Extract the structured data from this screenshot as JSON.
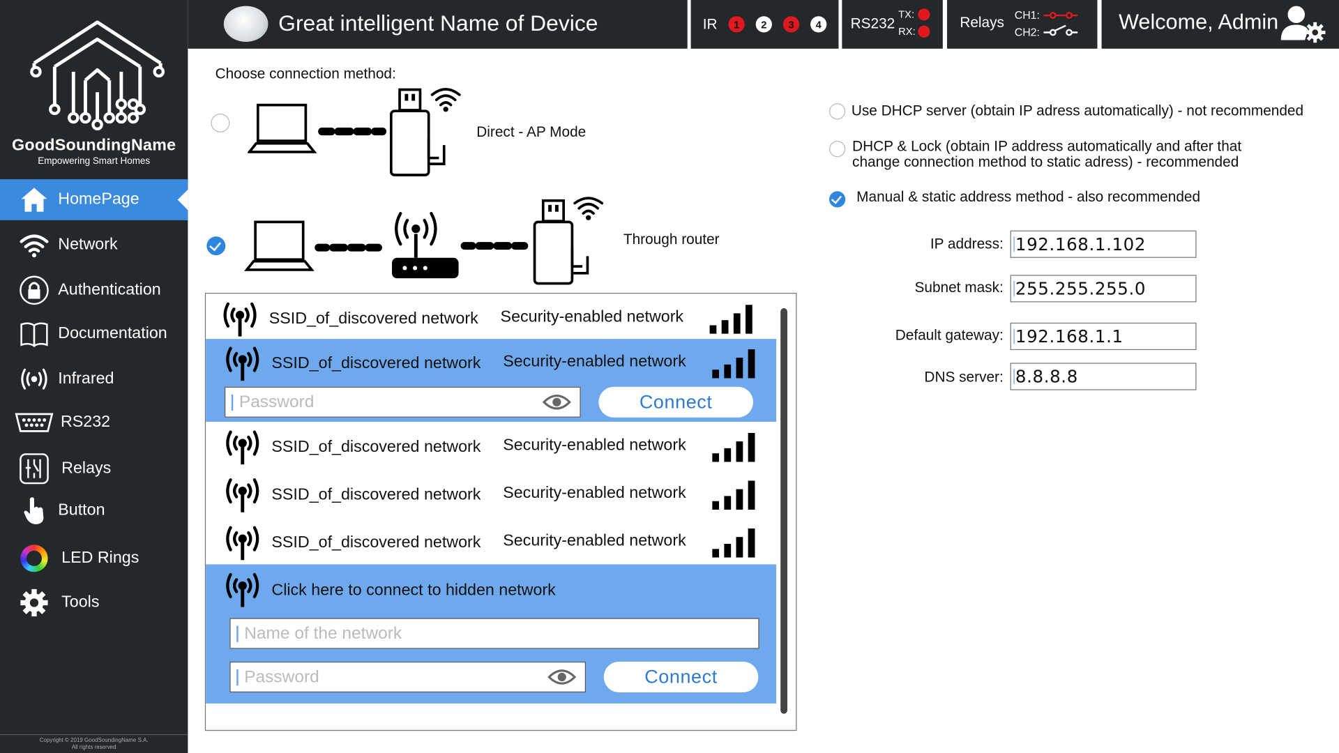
{
  "sidebar": {
    "brand": "GoodSoundingName",
    "tagline": "Empowering Smart Homes",
    "items": [
      {
        "label": "HomePage",
        "icon": "home-icon",
        "active": true
      },
      {
        "label": "Network",
        "icon": "wifi-icon"
      },
      {
        "label": "Authentication",
        "icon": "lock-icon"
      },
      {
        "label": "Documentation",
        "icon": "book-icon"
      },
      {
        "label": "Infrared",
        "icon": "infrared-icon"
      },
      {
        "label": "RS232",
        "icon": "serial-port-icon"
      },
      {
        "label": "Relays",
        "icon": "relay-icon"
      },
      {
        "label": "Button",
        "icon": "hand-pointer-icon"
      },
      {
        "label": "LED Rings",
        "icon": "led-ring-icon"
      },
      {
        "label": "Tools",
        "icon": "gear-icon"
      }
    ],
    "copyright_line1": "Copyright © 2019 GoodSoundingName S.A.",
    "copyright_line2": "All rights reserved"
  },
  "header": {
    "device_title": "Great intelligent Name of Device",
    "ir_label": "IR",
    "ir_channels": [
      {
        "num": "1",
        "state": "red"
      },
      {
        "num": "2",
        "state": "white"
      },
      {
        "num": "3",
        "state": "red"
      },
      {
        "num": "4",
        "state": "white"
      }
    ],
    "rs232_label": "RS232",
    "tx_label": "TX:",
    "rx_label": "RX:",
    "relays_label": "Relays",
    "ch1_label": "CH1:",
    "ch2_label": "CH2:",
    "welcome": "Welcome, Admin"
  },
  "connection": {
    "heading": "Choose connection method:",
    "direct_label": "Direct - AP Mode",
    "router_label": "Through router",
    "selected": "router"
  },
  "networks": [
    {
      "ssid": "SSID_of_discovered network",
      "security": "Security-enabled network",
      "expanded": false
    },
    {
      "ssid": "SSID_of_discovered network",
      "security": "Security-enabled network",
      "expanded": true
    },
    {
      "ssid": "SSID_of_discovered network",
      "security": "Security-enabled network",
      "expanded": false
    },
    {
      "ssid": "SSID_of_discovered network",
      "security": "Security-enabled network",
      "expanded": false
    },
    {
      "ssid": "SSID_of_discovered network",
      "security": "Security-enabled network",
      "expanded": false
    }
  ],
  "network_form": {
    "password_placeholder": "Password",
    "connect_label": "Connect"
  },
  "hidden_network": {
    "label": "Click here to connect to hidden network",
    "name_placeholder": "Name of the network",
    "password_placeholder": "Password",
    "connect_label": "Connect"
  },
  "ip_methods": {
    "dhcp": "Use DHCP server (obtain IP adress automatically) - not recommended",
    "dhcp_lock_line1": "DHCP & Lock (obtain IP address automatically and after that",
    "dhcp_lock_line2": "change connection method to static adress) - recommended",
    "manual": "Manual & static address method - also recommended",
    "selected": "manual"
  },
  "ip_settings": {
    "ip_label": "IP address:",
    "ip_value": "192.168.1.102",
    "subnet_label": "Subnet mask:",
    "subnet_value": "255.255.255.0",
    "gateway_label": "Default gateway:",
    "gateway_value": "192.168.1.1",
    "dns_label": "DNS server:",
    "dns_value": "8.8.8.8"
  },
  "colors": {
    "accent": "#3a8ae0",
    "sidebar": "#25282b",
    "highlight": "#6ea8ed",
    "status_red": "#e0191e"
  }
}
